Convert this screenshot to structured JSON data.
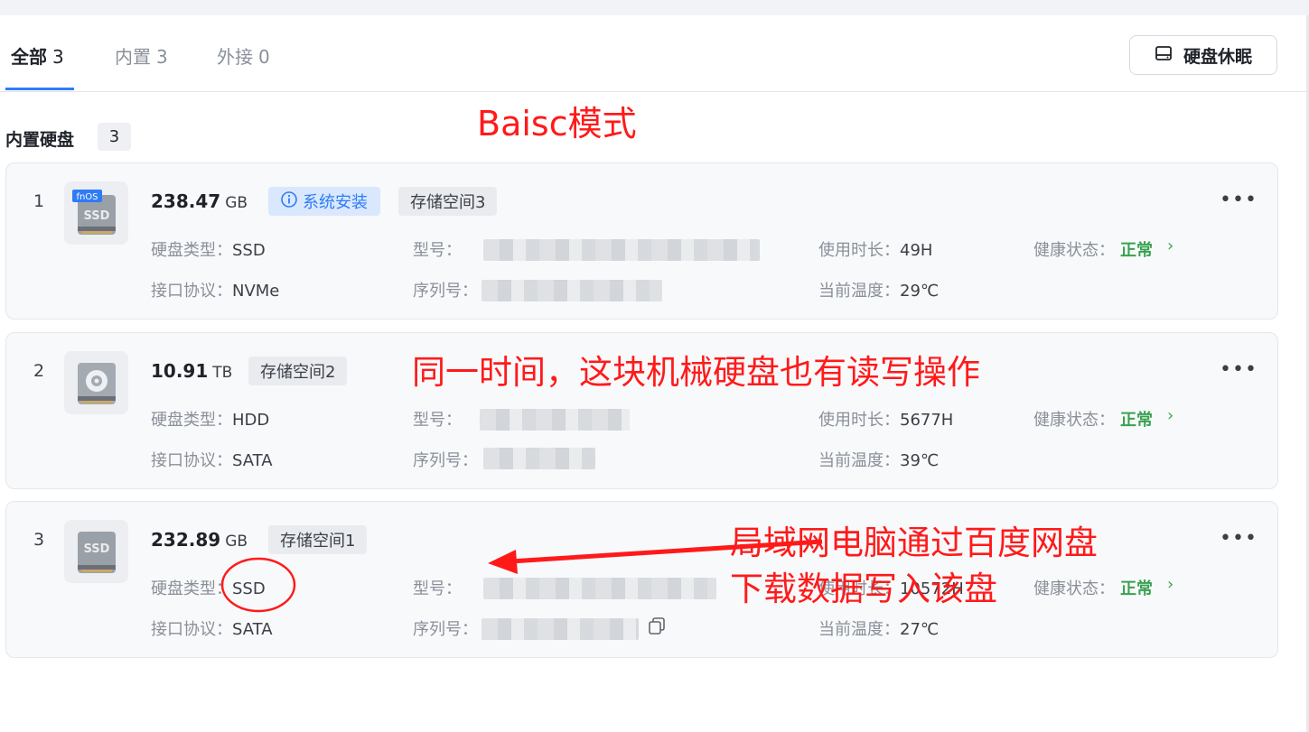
{
  "tabs": [
    {
      "label": "全部",
      "count": "3"
    },
    {
      "label": "内置",
      "count": "3"
    },
    {
      "label": "外接",
      "count": "0"
    }
  ],
  "sleep_button": {
    "label": "硬盘休眠",
    "icon": "drive-icon"
  },
  "section": {
    "title": "内置硬盘",
    "count": "3"
  },
  "field_labels": {
    "type": "硬盘类型：",
    "model": "型号：",
    "usage": "使用时长：",
    "health": "健康状态：",
    "interface": "接口协议：",
    "serial": "序列号：",
    "temp": "当前温度："
  },
  "disks": [
    {
      "index": "1",
      "size": "238.47",
      "unit": "GB",
      "icon": "ssd-fnos-icon",
      "icon_badge": "fnOS",
      "icon_text": "SSD",
      "system_tag": "系统安装",
      "storage_tag": "存储空间3",
      "type": "SSD",
      "interface": "NVMe",
      "usage": "49H",
      "temp": "29℃",
      "health": "正常"
    },
    {
      "index": "2",
      "size": "10.91",
      "unit": "TB",
      "icon": "hdd-icon",
      "storage_tag": "存储空间2",
      "type": "HDD",
      "interface": "SATA",
      "usage": "5677H",
      "temp": "39℃",
      "health": "正常"
    },
    {
      "index": "3",
      "size": "232.89",
      "unit": "GB",
      "icon": "ssd-icon",
      "icon_text": "SSD",
      "storage_tag": "存储空间1",
      "type": "SSD",
      "interface": "SATA",
      "usage": "10572H",
      "temp": "27℃",
      "health": "正常"
    }
  ],
  "annotations": {
    "mode": "Baisc模式",
    "hdd_note": "同一时间，这块机械硬盘也有读写操作",
    "ssd_note_line1": "局域网电脑通过百度网盘",
    "ssd_note_line2": "下载数据写入该盘"
  },
  "colors": {
    "accent": "#2f7cf6",
    "healthy": "#3aa150",
    "annotation": "#ff1a1a"
  }
}
